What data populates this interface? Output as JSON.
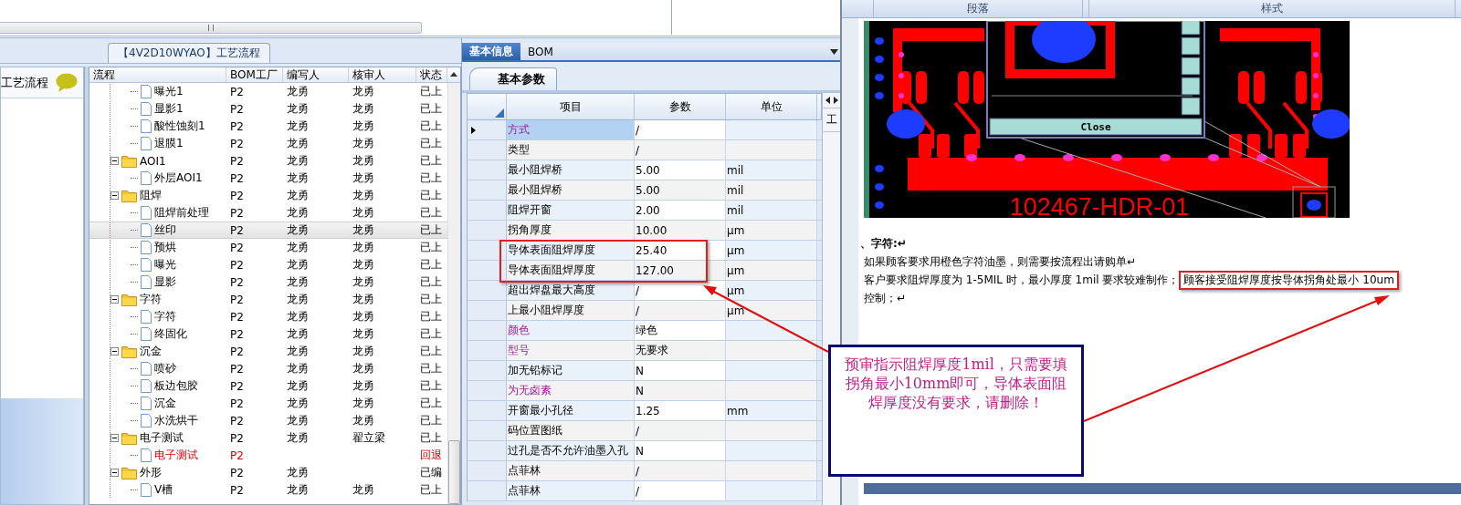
{
  "flow_panel": {
    "title": "【4V2D10WYAO】工艺流程"
  },
  "sidebar": {
    "title": "工艺流程"
  },
  "tree": {
    "columns": [
      "流程",
      "BOM工厂",
      "编写人",
      "核审人",
      "状态"
    ],
    "rows": [
      {
        "label": "曝光1",
        "kind": "leaf",
        "factory": "P2",
        "writer": "龙勇",
        "reviewer": "龙勇",
        "status": "已上",
        "error": false,
        "selected": false
      },
      {
        "label": "显影1",
        "kind": "leaf",
        "factory": "P2",
        "writer": "龙勇",
        "reviewer": "龙勇",
        "status": "已上",
        "error": false,
        "selected": false
      },
      {
        "label": "酸性蚀刻1",
        "kind": "leaf",
        "factory": "P2",
        "writer": "龙勇",
        "reviewer": "龙勇",
        "status": "已上",
        "error": false,
        "selected": false
      },
      {
        "label": "退膜1",
        "kind": "leaf",
        "factory": "P2",
        "writer": "龙勇",
        "reviewer": "龙勇",
        "status": "已上",
        "error": false,
        "selected": false
      },
      {
        "label": "AOI1",
        "kind": "folder",
        "expanded": true,
        "factory": "P2",
        "writer": "龙勇",
        "reviewer": "龙勇",
        "status": "已上",
        "error": false,
        "selected": false,
        "children": [
          {
            "label": "外层AOI1",
            "kind": "leaf",
            "factory": "P2",
            "writer": "龙勇",
            "reviewer": "龙勇",
            "status": "已上",
            "error": false,
            "selected": false
          }
        ]
      },
      {
        "label": "阻焊",
        "kind": "folder",
        "expanded": true,
        "factory": "P2",
        "writer": "龙勇",
        "reviewer": "龙勇",
        "status": "已上",
        "error": false,
        "selected": false,
        "children": [
          {
            "label": "阻焊前处理",
            "kind": "leaf",
            "factory": "P2",
            "writer": "龙勇",
            "reviewer": "龙勇",
            "status": "已上",
            "error": false,
            "selected": false
          },
          {
            "label": "丝印",
            "kind": "leaf",
            "factory": "P2",
            "writer": "龙勇",
            "reviewer": "龙勇",
            "status": "已上",
            "error": false,
            "selected": true
          },
          {
            "label": "预烘",
            "kind": "leaf",
            "factory": "P2",
            "writer": "龙勇",
            "reviewer": "龙勇",
            "status": "已上",
            "error": false,
            "selected": false
          },
          {
            "label": "曝光",
            "kind": "leaf",
            "factory": "P2",
            "writer": "龙勇",
            "reviewer": "龙勇",
            "status": "已上",
            "error": false,
            "selected": false
          },
          {
            "label": "显影",
            "kind": "leaf",
            "factory": "P2",
            "writer": "龙勇",
            "reviewer": "龙勇",
            "status": "已上",
            "error": false,
            "selected": false
          }
        ]
      },
      {
        "label": "字符",
        "kind": "folder",
        "expanded": true,
        "factory": "P2",
        "writer": "龙勇",
        "reviewer": "龙勇",
        "status": "已上",
        "error": false,
        "selected": false,
        "children": [
          {
            "label": "字符",
            "kind": "leaf",
            "factory": "P2",
            "writer": "龙勇",
            "reviewer": "龙勇",
            "status": "已上",
            "error": false,
            "selected": false
          },
          {
            "label": "终固化",
            "kind": "leaf",
            "factory": "P2",
            "writer": "龙勇",
            "reviewer": "龙勇",
            "status": "已上",
            "error": false,
            "selected": false
          }
        ]
      },
      {
        "label": "沉金",
        "kind": "folder",
        "expanded": true,
        "factory": "P2",
        "writer": "龙勇",
        "reviewer": "龙勇",
        "status": "已上",
        "error": false,
        "selected": false,
        "children": [
          {
            "label": "喷砂",
            "kind": "leaf",
            "factory": "P2",
            "writer": "龙勇",
            "reviewer": "龙勇",
            "status": "已上",
            "error": false,
            "selected": false
          },
          {
            "label": "板边包胶",
            "kind": "leaf",
            "factory": "P2",
            "writer": "龙勇",
            "reviewer": "龙勇",
            "status": "已上",
            "error": false,
            "selected": false
          },
          {
            "label": "沉金",
            "kind": "leaf",
            "factory": "P2",
            "writer": "龙勇",
            "reviewer": "龙勇",
            "status": "已上",
            "error": false,
            "selected": false
          },
          {
            "label": "水洗烘干",
            "kind": "leaf",
            "factory": "P2",
            "writer": "龙勇",
            "reviewer": "龙勇",
            "status": "已上",
            "error": false,
            "selected": false
          }
        ]
      },
      {
        "label": "电子测试",
        "kind": "folder",
        "expanded": true,
        "factory": "P2",
        "writer": "龙勇",
        "reviewer": "翟立梁",
        "status": "已上",
        "error": false,
        "selected": false,
        "children": [
          {
            "label": "电子测试",
            "kind": "leaf",
            "factory": "P2",
            "status": "回退",
            "error": true,
            "selected": false
          }
        ]
      },
      {
        "label": "外形",
        "kind": "folder",
        "expanded": true,
        "factory": "P2",
        "writer": "龙勇",
        "status": "已编",
        "error": false,
        "selected": false,
        "children": [
          {
            "label": "V槽",
            "kind": "leaf",
            "factory": "P2",
            "writer": "龙勇",
            "reviewer": "龙勇",
            "status": "已上",
            "error": false,
            "selected": false
          }
        ]
      }
    ]
  },
  "detail": {
    "tabs": [
      {
        "label": "基本信息",
        "selected": true
      },
      {
        "label": "BOM",
        "selected": false
      }
    ],
    "subtabs": [
      {
        "label": "基本参数",
        "selected": true
      }
    ],
    "columns": [
      "项目",
      "参数",
      "单位"
    ],
    "rows": [
      {
        "item": "方式",
        "value": "/",
        "required": true,
        "selected": true
      },
      {
        "item": "类型",
        "value": "/",
        "required": false,
        "selected": false
      },
      {
        "item": "最小阻焊桥",
        "value": "5.00",
        "unit": "mil",
        "required": false,
        "selected": false
      },
      {
        "item": "最小阻焊桥",
        "value": "5.00",
        "unit": "mil",
        "required": false,
        "selected": false
      },
      {
        "item": "阻焊开窗",
        "value": "2.00",
        "unit": "mil",
        "required": false,
        "selected": false
      },
      {
        "item": "拐角厚度",
        "value": "10.00",
        "unit": "μm",
        "required": false,
        "selected": false
      },
      {
        "item": "导体表面阻焊厚度",
        "value": "25.40",
        "unit": "μm",
        "required": false,
        "selected": false
      },
      {
        "item": "导体表面阻焊厚度",
        "value": "127.00",
        "unit": "μm",
        "required": false,
        "selected": false
      },
      {
        "item": "超出焊盘最大高度",
        "value": "/",
        "unit": "μm",
        "required": false,
        "selected": false
      },
      {
        "item": "上最小阻焊厚度",
        "value": "/",
        "unit": "μm",
        "required": false,
        "selected": false
      },
      {
        "item": "颜色",
        "value": "绿色",
        "required": true,
        "selected": false
      },
      {
        "item": "型号",
        "value": "无要求",
        "required": true,
        "selected": false
      },
      {
        "item": "加无铅标记",
        "value": "N",
        "required": false,
        "selected": false
      },
      {
        "item": "为无卤素",
        "value": "N",
        "required": true,
        "selected": false
      },
      {
        "item": "开窗最小孔径",
        "value": "1.25",
        "unit": "mm",
        "required": false,
        "selected": false
      },
      {
        "item": "码位置图纸",
        "value": "/",
        "required": false,
        "selected": false
      },
      {
        "item": "过孔是否不允许油墨入孔",
        "value": "N",
        "required": false,
        "selected": false
      },
      {
        "item": "点菲林",
        "value": "/",
        "required": false,
        "selected": false
      },
      {
        "item": "点菲林",
        "value": "/",
        "required": false,
        "selected": false
      }
    ]
  },
  "side_panel": {
    "label": "工"
  },
  "document": {
    "ribbon": [
      "段落",
      "样式"
    ],
    "figure": {
      "part_number": "102467-HDR-01",
      "button": "Close"
    },
    "heading": "、字符:↵",
    "lines": [
      [
        {
          "text": "如果顾客要求用橙色字符油墨，则需要按流程出请购单↵",
          "highlighted": false
        }
      ],
      [
        {
          "text": "客户要求阻焊厚度为 1-5MIL 时，最小厚度 1mil 要求较难制作；",
          "highlighted": false
        },
        {
          "text": "顾客接受阻焊厚度按导体拐角处最小 10um",
          "highlighted": true
        }
      ],
      [
        {
          "text": "控制；↵",
          "highlighted": false
        }
      ]
    ]
  },
  "callout": {
    "text": "预审指示阻焊厚度1mil，只需要填拐角最小10mm即可，导体表面阻焊厚度没有要求，请删除！"
  }
}
